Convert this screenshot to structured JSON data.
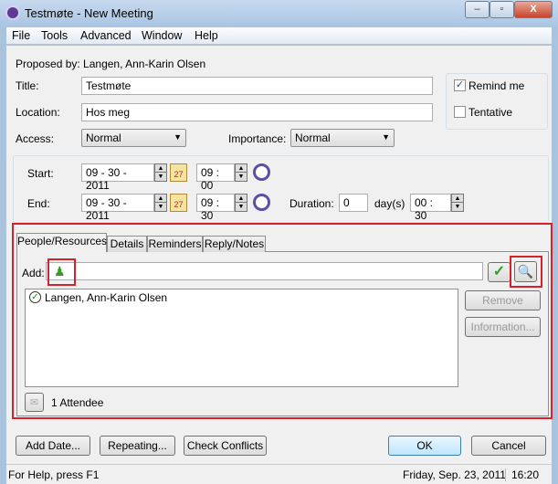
{
  "window": {
    "title": "Testmøte - New Meeting",
    "minimize": "–",
    "maximize": "▫",
    "close": "X"
  },
  "menu": [
    "File",
    "Tools",
    "Advanced",
    "Window",
    "Help"
  ],
  "proposed_by": "Proposed by: Langen, Ann-Karin Olsen",
  "title": {
    "label": "Title:",
    "value": "Testmøte"
  },
  "location": {
    "label": "Location:",
    "value": "Hos meg"
  },
  "remind_me": {
    "label": "Remind me",
    "checked": true
  },
  "tentative": {
    "label": "Tentative",
    "checked": false
  },
  "access": {
    "label": "Access:",
    "value": "Normal"
  },
  "importance": {
    "label": "Importance:",
    "value": "Normal"
  },
  "start": {
    "label": "Start:",
    "date": "09 - 30 - 2011",
    "time": "09 : 00"
  },
  "end": {
    "label": "End:",
    "date": "09 - 30 - 2011",
    "time": "09 : 30"
  },
  "calendar_icon_text": "27",
  "duration": {
    "label": "Duration:",
    "days": "0",
    "days_label": "day(s)",
    "time": "00 : 30"
  },
  "tabs": [
    "People/Resources",
    "Details",
    "Reminders",
    "Reply/Notes"
  ],
  "active_tab": "People/Resources",
  "add": {
    "label": "Add:",
    "value": ""
  },
  "attendees": [
    "Langen, Ann-Karin Olsen"
  ],
  "remove_label": "Remove",
  "information_label": "Information...",
  "attendee_count": "1 Attendee",
  "buttons": {
    "add_date": "Add Date...",
    "repeating": "Repeating...",
    "check_conflicts": "Check Conflicts",
    "ok": "OK",
    "cancel": "Cancel"
  },
  "status": {
    "help": "For Help, press F1",
    "date": "Friday, Sep. 23, 2011",
    "time": "16:20"
  },
  "colors": {
    "highlight": "#d4222c",
    "accent": "#5b3b96"
  }
}
